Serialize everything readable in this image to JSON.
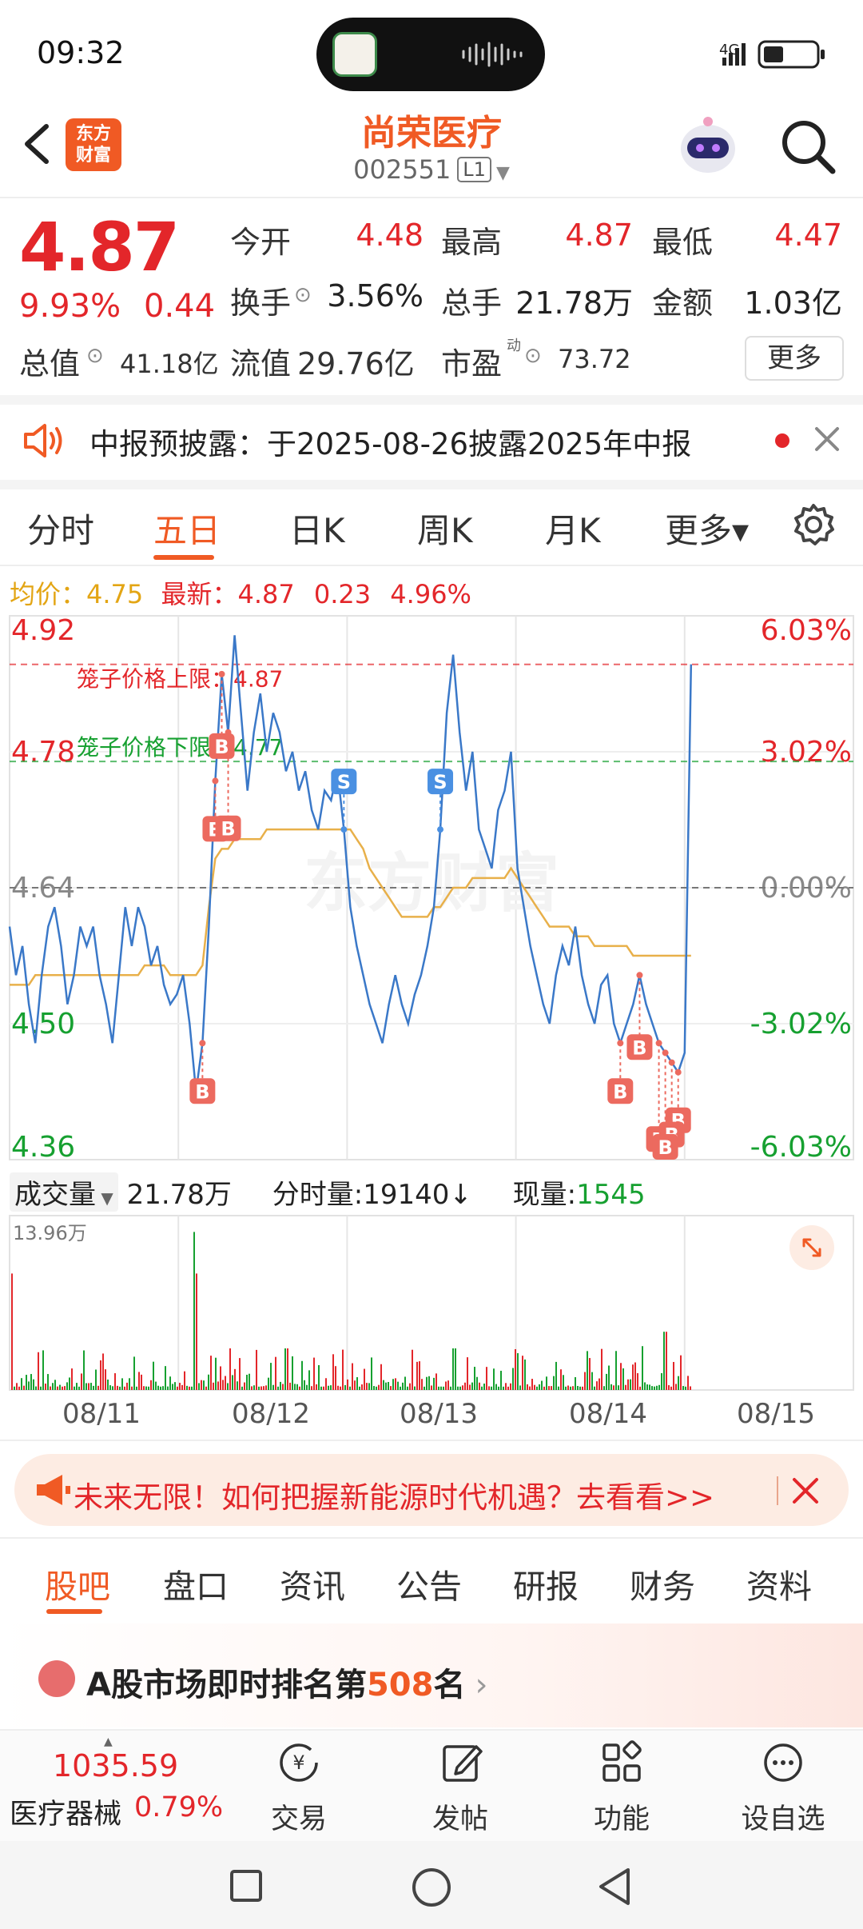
{
  "status_bar": {
    "time": "09:32",
    "network": "4G"
  },
  "header": {
    "logo_line1": "东方",
    "logo_line2": "财富",
    "stock_name": "尚荣医疗",
    "stock_code": "002551",
    "level": "L1"
  },
  "quote": {
    "price": "4.87",
    "change_pct": "9.93%",
    "change": "0.44",
    "open_label": "今开",
    "open": "4.48",
    "high_label": "最高",
    "high": "4.87",
    "low_label": "最低",
    "low": "4.47",
    "turnover_label": "换手",
    "turnover": "3.56%",
    "volume_label": "总手",
    "volume": "21.78万",
    "amount_label": "金额",
    "amount": "1.03亿",
    "mktcap_label": "总值",
    "mktcap": "41.18亿",
    "float_label": "流值",
    "float_cap": "29.76亿",
    "pe_label": "市盈",
    "pe_sup": "动",
    "pe": "73.72",
    "more": "更多"
  },
  "notice": {
    "text": "中报预披露：于2025-08-26披露2025年中报"
  },
  "chart_tabs": [
    "分时",
    "五日",
    "日K",
    "周K",
    "月K",
    "更多▾"
  ],
  "chart_tab_active": "五日",
  "stats": {
    "avg_label": "均价：",
    "avg": "4.75",
    "latest_label": "最新：",
    "latest": "4.87",
    "chg": "0.23",
    "pct": "4.96%"
  },
  "chart_data": {
    "type": "line",
    "title": "",
    "x_dates": [
      "08/11",
      "08/12",
      "08/13",
      "08/14",
      "08/15"
    ],
    "y_ticks_left": [
      "4.92",
      "4.78",
      "4.64",
      "4.50",
      "4.36"
    ],
    "y_ticks_right": [
      "6.03%",
      "3.02%",
      "0.00%",
      "-3.02%",
      "-6.03%"
    ],
    "ylim": [
      4.36,
      4.92
    ],
    "prev_close": 4.64,
    "cage_upper_label": "笼子价格上限：4.87",
    "cage_upper": 4.87,
    "cage_lower_label": "笼子价格下限：4.77",
    "cage_lower": 4.77,
    "watermark": "东方财富",
    "series": [
      {
        "role": "price",
        "values": [
          4.6,
          4.55,
          4.58,
          4.52,
          4.48,
          4.55,
          4.6,
          4.62,
          4.58,
          4.52,
          4.55,
          4.6,
          4.58,
          4.6,
          4.55,
          4.52,
          4.48,
          4.55,
          4.62,
          4.58,
          4.62,
          4.6,
          4.56,
          4.58,
          4.54,
          4.52,
          4.53,
          4.55,
          4.5,
          4.43,
          4.48,
          4.6,
          4.75,
          4.86,
          4.8,
          4.9,
          4.82,
          4.74,
          4.8,
          4.84,
          4.78,
          4.82,
          4.8,
          4.76,
          4.78,
          4.74,
          4.76,
          4.72,
          4.7,
          4.74,
          4.73,
          4.76,
          4.7,
          4.62,
          4.58,
          4.55,
          4.52,
          4.5,
          4.48,
          4.52,
          4.55,
          4.52,
          4.5,
          4.53,
          4.55,
          4.58,
          4.62,
          4.7,
          4.82,
          4.88,
          4.8,
          4.74,
          4.78,
          4.7,
          4.68,
          4.66,
          4.72,
          4.74,
          4.78,
          4.66,
          4.62,
          4.58,
          4.55,
          4.52,
          4.5,
          4.55,
          4.58,
          4.56,
          4.6,
          4.55,
          4.52,
          4.5,
          4.54,
          4.55,
          4.5,
          4.48,
          4.5,
          4.52,
          4.55,
          4.52,
          4.5,
          4.48,
          4.47,
          4.46,
          4.45,
          4.47,
          4.87
        ]
      },
      {
        "role": "average",
        "values": [
          4.54,
          4.54,
          4.54,
          4.54,
          4.55,
          4.55,
          4.55,
          4.55,
          4.55,
          4.55,
          4.55,
          4.55,
          4.55,
          4.55,
          4.55,
          4.55,
          4.55,
          4.55,
          4.55,
          4.55,
          4.55,
          4.56,
          4.56,
          4.56,
          4.56,
          4.55,
          4.55,
          4.55,
          4.55,
          4.55,
          4.56,
          4.62,
          4.67,
          4.68,
          4.68,
          4.69,
          4.69,
          4.69,
          4.69,
          4.69,
          4.7,
          4.7,
          4.7,
          4.7,
          4.7,
          4.7,
          4.7,
          4.7,
          4.7,
          4.7,
          4.7,
          4.7,
          4.7,
          4.7,
          4.69,
          4.68,
          4.66,
          4.65,
          4.64,
          4.63,
          4.62,
          4.61,
          4.61,
          4.61,
          4.61,
          4.61,
          4.62,
          4.62,
          4.63,
          4.64,
          4.64,
          4.64,
          4.65,
          4.65,
          4.65,
          4.65,
          4.65,
          4.65,
          4.66,
          4.65,
          4.64,
          4.63,
          4.62,
          4.61,
          4.6,
          4.6,
          4.6,
          4.6,
          4.59,
          4.59,
          4.59,
          4.58,
          4.58,
          4.58,
          4.58,
          4.58,
          4.58,
          4.57,
          4.57,
          4.57,
          4.57,
          4.57,
          4.57,
          4.57,
          4.57,
          4.57,
          4.57
        ]
      }
    ],
    "trade_markers": [
      "B",
      "B",
      "B",
      "B",
      "S",
      "S",
      "B",
      "B",
      "B",
      "B",
      "B",
      "B"
    ]
  },
  "volume_row": {
    "label": "成交量",
    "total": "21.78万",
    "tick_label": "分时量:",
    "tick": "19140",
    "arrow": "↓",
    "cur_label": "现量:",
    "cur": "1545",
    "max_label": "13.96万"
  },
  "ad": {
    "text": "未来无限！如何把握新能源时代机遇？去看看>>"
  },
  "bottom_tabs": [
    "股吧",
    "盘口",
    "资讯",
    "公告",
    "研报",
    "财务",
    "资料"
  ],
  "bottom_tab_active": "股吧",
  "ranking": {
    "prefix": "A股市场即时排名第",
    "rank": "508",
    "suffix": "名"
  },
  "bottom_bar": {
    "index_value": "1035.59",
    "index_name": "医疗器械",
    "index_pct": "0.79%",
    "items": [
      "交易",
      "发帖",
      "功能",
      "设自选"
    ]
  },
  "colors": {
    "brand": "#f05a24",
    "up": "#e3262a",
    "down": "#16a030",
    "avg_line": "#e3a514",
    "price_line": "#3a78c8"
  }
}
